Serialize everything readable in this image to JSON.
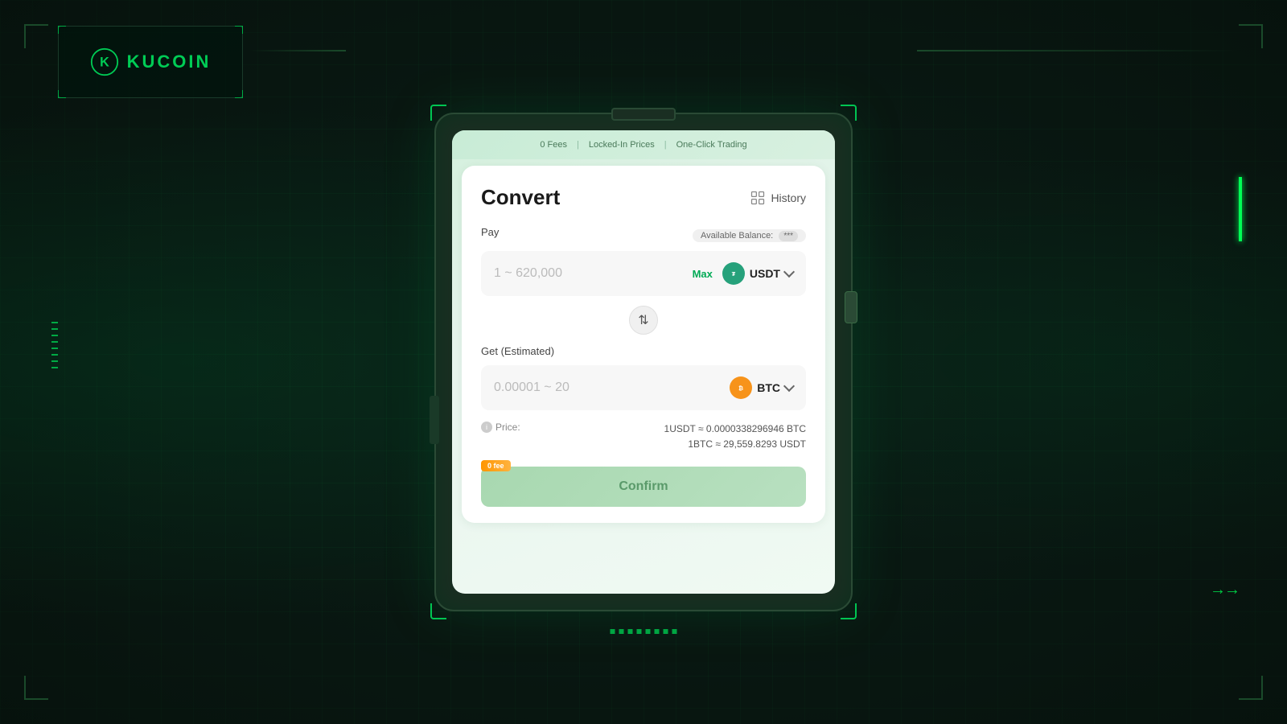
{
  "brand": {
    "name": "KUCOIN",
    "logo_alt": "KuCoin Logo"
  },
  "hud": {
    "arrow_right": "→→"
  },
  "feature_bar": {
    "items": [
      "0 Fees",
      "Locked-In Prices",
      "One-Click Trading"
    ],
    "divider": "|"
  },
  "convert_card": {
    "title": "Convert",
    "history_label": "History",
    "pay_label": "Pay",
    "available_balance_label": "Available Balance:",
    "available_balance_value": "***",
    "pay_placeholder": "1 ~ 620,000",
    "max_label": "Max",
    "pay_token": "USDT",
    "get_label": "Get (Estimated)",
    "get_placeholder": "0.00001 ~ 20",
    "get_token": "BTC",
    "price_label": "Price:",
    "price_line1": "1USDT ≈ 0.0000338296946 BTC",
    "price_line2": "1BTC ≈ 29,559.8293 USDT",
    "zero_fee_tag": "0 fee",
    "confirm_label": "Confirm"
  }
}
